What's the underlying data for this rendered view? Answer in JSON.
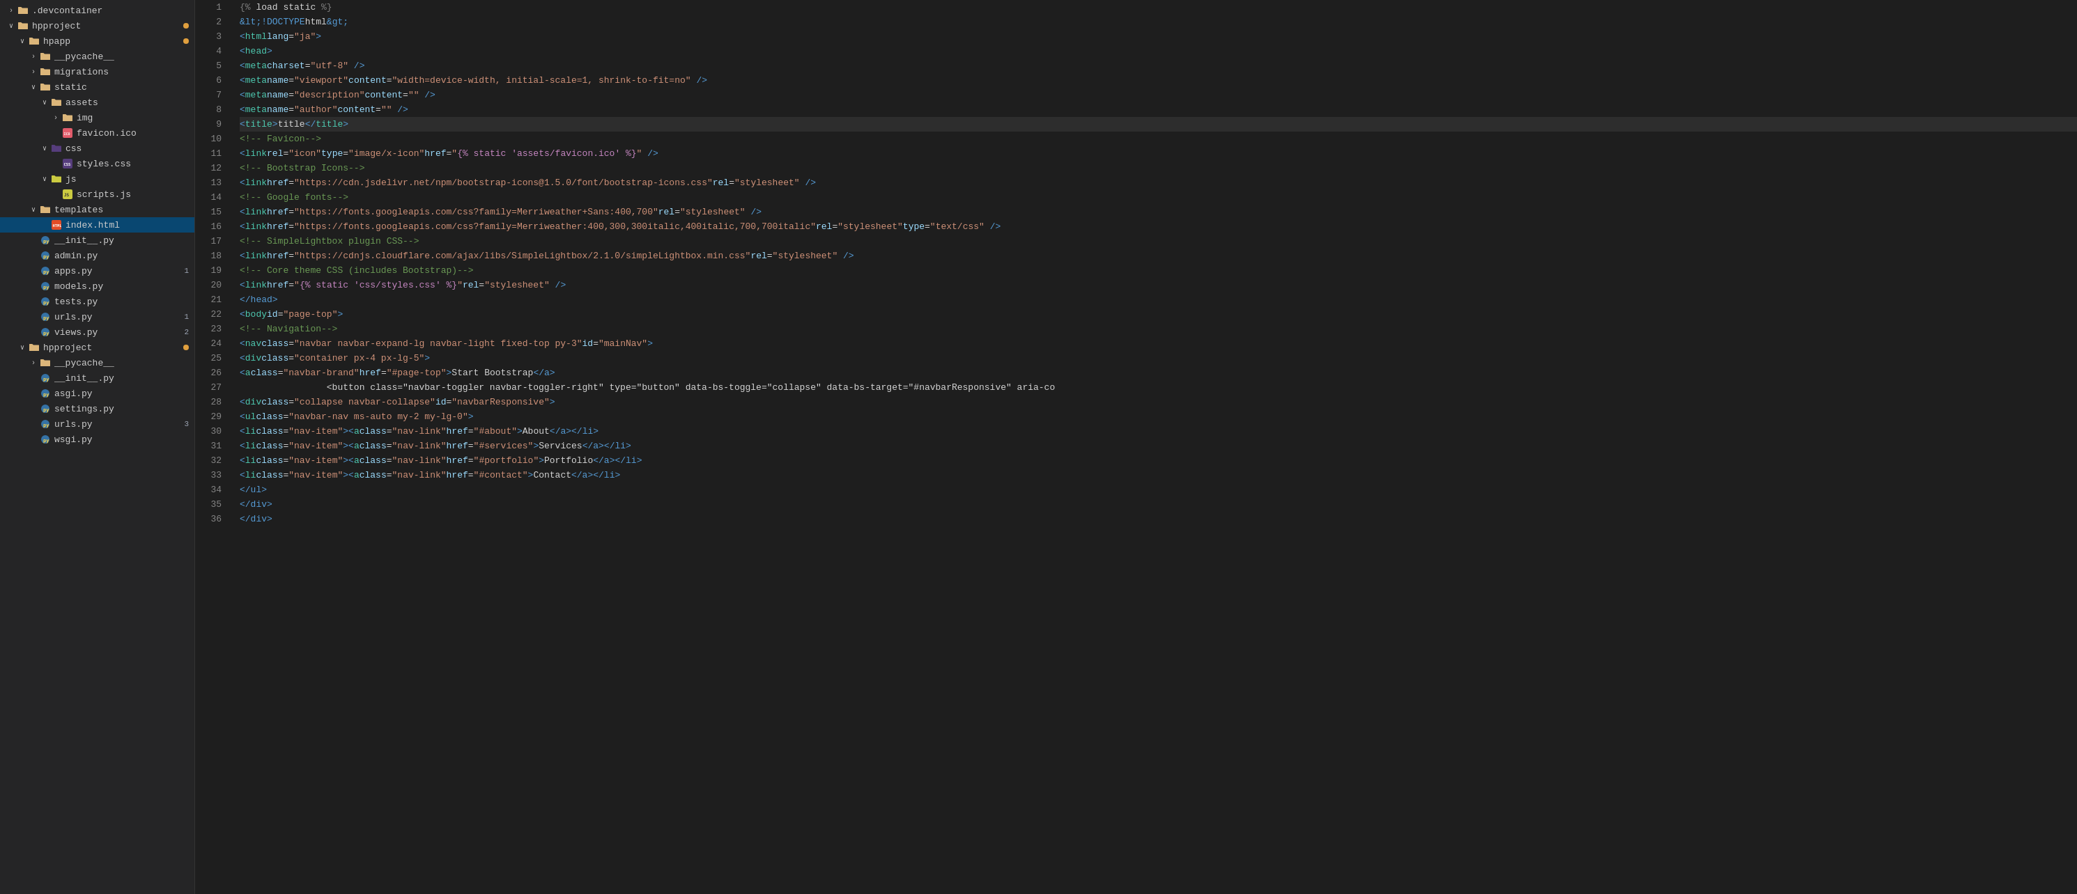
{
  "sidebar": {
    "items": [
      {
        "id": "devcontainer",
        "label": ".devcontainer",
        "type": "folder",
        "depth": 0,
        "expanded": false,
        "arrow": "›",
        "dot": ""
      },
      {
        "id": "hpproject-root",
        "label": "hpproject",
        "type": "folder",
        "depth": 0,
        "expanded": true,
        "arrow": "›",
        "dot": "orange"
      },
      {
        "id": "hpapp",
        "label": "hpapp",
        "type": "folder",
        "depth": 1,
        "expanded": true,
        "arrow": "›",
        "dot": "orange"
      },
      {
        "id": "pycache-hpapp",
        "label": "__pycache__",
        "type": "folder",
        "depth": 2,
        "expanded": false,
        "arrow": "›",
        "dot": ""
      },
      {
        "id": "migrations",
        "label": "migrations",
        "type": "folder",
        "depth": 2,
        "expanded": false,
        "arrow": "›",
        "dot": ""
      },
      {
        "id": "static",
        "label": "static",
        "type": "folder",
        "depth": 2,
        "expanded": true,
        "arrow": "›",
        "dot": ""
      },
      {
        "id": "assets",
        "label": "assets",
        "type": "folder",
        "depth": 3,
        "expanded": true,
        "arrow": "›",
        "dot": ""
      },
      {
        "id": "img",
        "label": "img",
        "type": "folder",
        "depth": 4,
        "expanded": false,
        "arrow": "›",
        "dot": ""
      },
      {
        "id": "favicon-ico",
        "label": "favicon.ico",
        "type": "ico",
        "depth": 4,
        "expanded": false,
        "arrow": "",
        "dot": ""
      },
      {
        "id": "css",
        "label": "css",
        "type": "folder-css",
        "depth": 3,
        "expanded": true,
        "arrow": "›",
        "dot": ""
      },
      {
        "id": "styles-css",
        "label": "styles.css",
        "type": "css",
        "depth": 4,
        "expanded": false,
        "arrow": "",
        "dot": ""
      },
      {
        "id": "js",
        "label": "js",
        "type": "folder-js",
        "depth": 3,
        "expanded": true,
        "arrow": "›",
        "dot": ""
      },
      {
        "id": "scripts-js",
        "label": "scripts.js",
        "type": "js",
        "depth": 4,
        "expanded": false,
        "arrow": "",
        "dot": ""
      },
      {
        "id": "templates",
        "label": "templates",
        "type": "folder",
        "depth": 2,
        "expanded": true,
        "arrow": "›",
        "dot": ""
      },
      {
        "id": "index-html",
        "label": "index.html",
        "type": "html",
        "depth": 3,
        "expanded": false,
        "arrow": "",
        "dot": "",
        "selected": true
      },
      {
        "id": "init-py-hpapp",
        "label": "__init__.py",
        "type": "py",
        "depth": 2,
        "expanded": false,
        "arrow": "",
        "dot": ""
      },
      {
        "id": "admin-py",
        "label": "admin.py",
        "type": "py",
        "depth": 2,
        "expanded": false,
        "arrow": "",
        "dot": ""
      },
      {
        "id": "apps-py",
        "label": "apps.py",
        "type": "py",
        "depth": 2,
        "expanded": false,
        "arrow": "",
        "dot": "",
        "badge": "1"
      },
      {
        "id": "models-py",
        "label": "models.py",
        "type": "py",
        "depth": 2,
        "expanded": false,
        "arrow": "",
        "dot": ""
      },
      {
        "id": "tests-py",
        "label": "tests.py",
        "type": "py",
        "depth": 2,
        "expanded": false,
        "arrow": "",
        "dot": ""
      },
      {
        "id": "urls-py-hpapp",
        "label": "urls.py",
        "type": "py",
        "depth": 2,
        "expanded": false,
        "arrow": "",
        "dot": "",
        "badge": "1"
      },
      {
        "id": "views-py",
        "label": "views.py",
        "type": "py",
        "depth": 2,
        "expanded": false,
        "arrow": "",
        "dot": "",
        "badge": "2"
      },
      {
        "id": "hpproject-inner",
        "label": "hpproject",
        "type": "folder",
        "depth": 1,
        "expanded": true,
        "arrow": "›",
        "dot": "orange"
      },
      {
        "id": "pycache-hpproject",
        "label": "__pycache__",
        "type": "folder",
        "depth": 2,
        "expanded": false,
        "arrow": "›",
        "dot": ""
      },
      {
        "id": "init-py-hpproject",
        "label": "__init__.py",
        "type": "py",
        "depth": 2,
        "expanded": false,
        "arrow": "",
        "dot": ""
      },
      {
        "id": "asgi-py",
        "label": "asgi.py",
        "type": "py",
        "depth": 2,
        "expanded": false,
        "arrow": "",
        "dot": ""
      },
      {
        "id": "settings-py",
        "label": "settings.py",
        "type": "py",
        "depth": 2,
        "expanded": false,
        "arrow": "",
        "dot": ""
      },
      {
        "id": "urls-py-hpproject",
        "label": "urls.py",
        "type": "py",
        "depth": 2,
        "expanded": false,
        "arrow": "",
        "dot": "",
        "badge": "3"
      },
      {
        "id": "wsgi-py",
        "label": "wsgi.py",
        "type": "py",
        "depth": 2,
        "expanded": false,
        "arrow": "",
        "dot": ""
      }
    ]
  },
  "editor": {
    "lines": [
      {
        "num": 1,
        "content": "django_tag_open",
        "text": "{% load static %}"
      },
      {
        "num": 2,
        "content": "doctype",
        "text": "<!DOCTYPE html>"
      },
      {
        "num": 3,
        "content": "html_open",
        "text": "<html lang=\"ja\">"
      },
      {
        "num": 4,
        "content": "head_open",
        "text": "    <head>"
      },
      {
        "num": 5,
        "content": "meta_charset",
        "text": "        <meta charset=\"utf-8\" />"
      },
      {
        "num": 6,
        "content": "meta_viewport",
        "text": "        <meta name=\"viewport\" content=\"width=device-width, initial-scale=1, shrink-to-fit=no\" />"
      },
      {
        "num": 7,
        "content": "meta_description",
        "text": "        <meta name=\"description\" content=\"\" />"
      },
      {
        "num": 8,
        "content": "meta_author",
        "text": "        <meta name=\"author\" content=\"\" />"
      },
      {
        "num": 9,
        "content": "title",
        "text": "        <title>title</title>"
      },
      {
        "num": 10,
        "content": "comment_favicon",
        "text": "        <!-- Favicon-->"
      },
      {
        "num": 11,
        "content": "link_favicon",
        "text": "        <link rel=\"icon\" type=\"image/x-icon\" href=\"{% static 'assets/favicon.ico' %}\" />"
      },
      {
        "num": 12,
        "content": "comment_bi",
        "text": "        <!-- Bootstrap Icons-->"
      },
      {
        "num": 13,
        "content": "link_bi",
        "text": "        <link href=\"https://cdn.jsdelivr.net/npm/bootstrap-icons@1.5.0/font/bootstrap-icons.css\" rel=\"stylesheet\" />"
      },
      {
        "num": 14,
        "content": "comment_gf",
        "text": "        <!-- Google fonts-->"
      },
      {
        "num": 15,
        "content": "link_gf1",
        "text": "        <link href=\"https://fonts.googleapis.com/css?family=Merriweather+Sans:400,700\" rel=\"stylesheet\" />"
      },
      {
        "num": 16,
        "content": "link_gf2",
        "text": "        <link href=\"https://fonts.googleapis.com/css?family=Merriweather:400,300,300italic,400italic,700,700italic\" rel=\"stylesheet\" type=\"text/css\" />"
      },
      {
        "num": 17,
        "content": "comment_slb_css",
        "text": "        <!-- SimpleLightbox plugin CSS-->"
      },
      {
        "num": 18,
        "content": "link_slb",
        "text": "        <link href=\"https://cdnjs.cloudflare.com/ajax/libs/SimpleLightbox/2.1.0/simpleLightbox.min.css\" rel=\"stylesheet\" />"
      },
      {
        "num": 19,
        "content": "comment_core",
        "text": "        <!-- Core theme CSS (includes Bootstrap)-->"
      },
      {
        "num": 20,
        "content": "link_core",
        "text": "        <link href=\"{% static 'css/styles.css' %}\" rel=\"stylesheet\" />"
      },
      {
        "num": 21,
        "content": "head_close",
        "text": "    </head>"
      },
      {
        "num": 22,
        "content": "body_open",
        "text": "    <body id=\"page-top\">"
      },
      {
        "num": 23,
        "content": "comment_nav",
        "text": "        <!-- Navigation-->"
      },
      {
        "num": 24,
        "content": "nav_open",
        "text": "        <nav class=\"navbar navbar-expand-lg navbar-light fixed-top py-3\" id=\"mainNav\">"
      },
      {
        "num": 25,
        "content": "div_container",
        "text": "            <div class=\"container px-4 px-lg-5\">"
      },
      {
        "num": 26,
        "content": "a_brand",
        "text": "                <a class=\"navbar-brand\" href=\"#page-top\">Start Bootstrap</a>"
      },
      {
        "num": 27,
        "content": "button_toggler",
        "text": "                <button class=\"navbar-toggler navbar-toggler-right\" type=\"button\" data-bs-toggle=\"collapse\" data-bs-target=\"#navbarResponsive\" aria-co"
      },
      {
        "num": 28,
        "content": "div_collapse",
        "text": "                <div class=\"collapse navbar-collapse\" id=\"navbarResponsive\">"
      },
      {
        "num": 29,
        "content": "ul_nav",
        "text": "                    <ul class=\"navbar-nav ms-auto my-2 my-lg-0\">"
      },
      {
        "num": 30,
        "content": "li_about",
        "text": "                        <li class=\"nav-item\"><a class=\"nav-link\" href=\"#about\">About</a></li>"
      },
      {
        "num": 31,
        "content": "li_services",
        "text": "                        <li class=\"nav-item\"><a class=\"nav-link\" href=\"#services\">Services</a></li>"
      },
      {
        "num": 32,
        "content": "li_portfolio",
        "text": "                        <li class=\"nav-item\"><a class=\"nav-link\" href=\"#portfolio\">Portfolio</a></li>"
      },
      {
        "num": 33,
        "content": "li_contact",
        "text": "                        <li class=\"nav-item\"><a class=\"nav-link\" href=\"#contact\">Contact</a></li>"
      },
      {
        "num": 34,
        "content": "ul_close",
        "text": "                    </ul>"
      },
      {
        "num": 35,
        "content": "div_close1",
        "text": "                </div>"
      },
      {
        "num": 36,
        "content": "div_close2",
        "text": "            </div>"
      }
    ]
  }
}
